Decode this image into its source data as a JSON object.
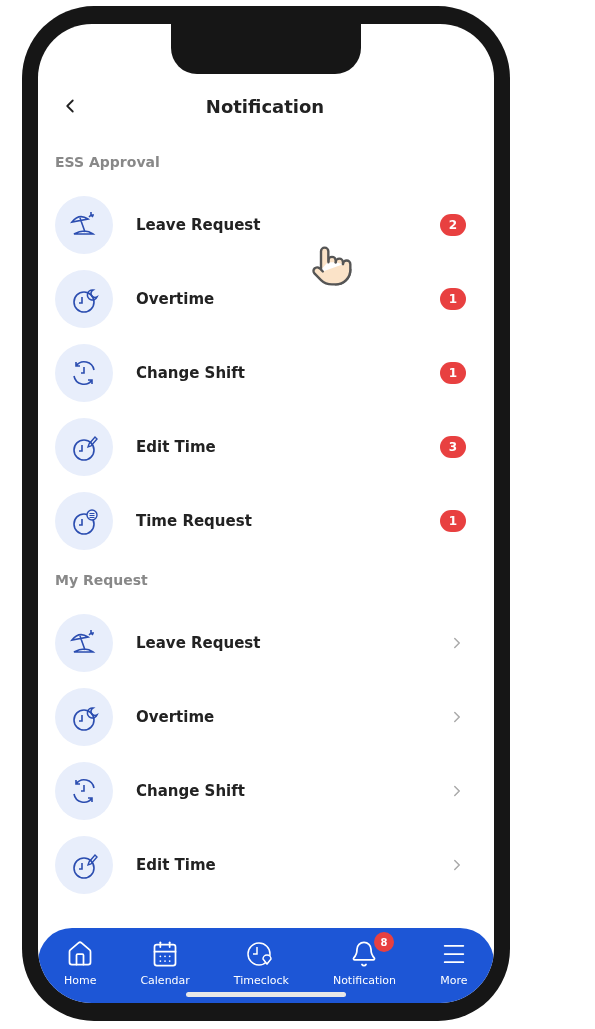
{
  "header": {
    "title": "Notification"
  },
  "sections": [
    {
      "title": "ESS Approval",
      "items": [
        {
          "kind": "leave",
          "label": "Leave Request",
          "count": "2"
        },
        {
          "kind": "overtime",
          "label": "Overtime",
          "count": "1"
        },
        {
          "kind": "shift",
          "label": "Change Shift",
          "count": "1"
        },
        {
          "kind": "edit",
          "label": "Edit Time",
          "count": "3"
        },
        {
          "kind": "request",
          "label": "Time Request",
          "count": "1"
        }
      ]
    },
    {
      "title": "My Request",
      "items": [
        {
          "kind": "leave",
          "label": "Leave Request"
        },
        {
          "kind": "overtime",
          "label": "Overtime"
        },
        {
          "kind": "shift",
          "label": "Change Shift"
        },
        {
          "kind": "edit",
          "label": "Edit Time"
        }
      ]
    }
  ],
  "nav": [
    {
      "kind": "home",
      "label": "Home"
    },
    {
      "kind": "calendar",
      "label": "Calendar"
    },
    {
      "kind": "timeclock",
      "label": "Timeclock"
    },
    {
      "kind": "bell",
      "label": "Notification",
      "badge": "8"
    },
    {
      "kind": "menu",
      "label": "More"
    }
  ]
}
